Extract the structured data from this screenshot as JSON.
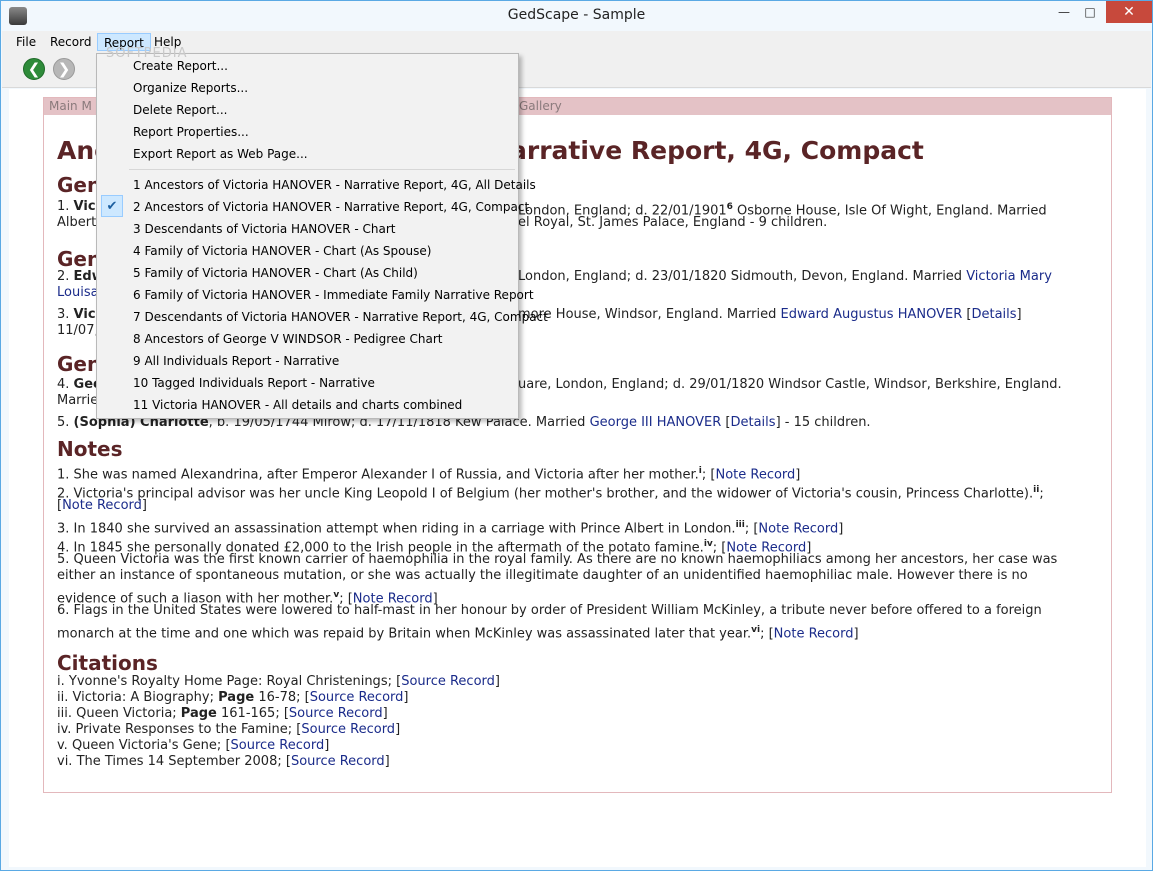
{
  "window": {
    "title": "GedScape - Sample",
    "min_label": "—",
    "max_label": "□",
    "close_label": "✕"
  },
  "menubar": {
    "file": "File",
    "record": "Record",
    "report": "Report",
    "help": "Help"
  },
  "toolbar": {
    "back_icon": "❮",
    "forward_icon": "❯"
  },
  "watermark": "SOFTPEDIA",
  "tabs": {
    "main": "Main M",
    "gallery": "Gallery"
  },
  "report_menu": {
    "actions": [
      "Create Report...",
      "Organize Reports...",
      "Delete Report...",
      "Report Properties...",
      "Export Report as Web Page..."
    ],
    "reports": [
      "1 Ancestors of Victoria HANOVER - Narrative Report, 4G, All Details",
      "2 Ancestors of Victoria HANOVER - Narrative Report, 4G, Compact",
      "3 Descendants of Victoria HANOVER - Chart",
      "4 Family of Victoria HANOVER - Chart (As Spouse)",
      "5 Family of Victoria HANOVER - Chart (As Child)",
      "6 Family of Victoria HANOVER - Immediate Family Narrative Report",
      "7 Descendants of Victoria HANOVER - Narrative Report, 4G, Compact",
      "8 Ancestors of George V WINDSOR - Pedigree Chart",
      "9 All Individuals Report - Narrative",
      "10 Tagged Individuals Report - Narrative",
      "11 Victoria HANOVER - All details and charts combined"
    ],
    "checked_mark": "✔"
  },
  "report": {
    "title_left": "Anc",
    "title_right": "arrative Report, 4G, Compact",
    "gen1": "Gen",
    "gen2": "Gen",
    "gen3": "Gen",
    "line_1a_num": "1.",
    "line_1a_bold": "Vic",
    "line_1a_tail": "London, England; d. 22/01/1901",
    "line_1a_sup": "6",
    "line_1a_tail2": " Osborne House, Isle Of Wight, England. Married",
    "line_1b_head": "Albert",
    "line_1b_tail": "el Royal, St. James Palace, England - 9 children.",
    "line_2a_num": "2.",
    "line_2a_bold": "Edw",
    "line_2a_tail": "London, England; d. 23/01/1820 Sidmouth, Devon, England. Married ",
    "line_2a_link": "Victoria Mary",
    "line_2b_link": "Louisa",
    "line_3a_num": "3.",
    "line_3a_bold": "Vic",
    "line_3a_tail": "more House, Windsor, England. Married ",
    "line_3a_link": "Edward Augustus HANOVER",
    "line_3a_bracket_open": " [",
    "line_3a_details": "Details",
    "line_3a_bracket_close": "]",
    "line_3b_head": "11/07,",
    "line_4a_num": "4.",
    "line_4a_bold": "Geo",
    "line_4a_tail": "uare, London, England; d. 29/01/1820 Windsor Castle, Windsor, Berkshire, England.",
    "line_4b_head": "Marrie",
    "line_5_num": "5. ",
    "line_5_bold": "(Sophia) Charlotte",
    "line_5_tail": ", b. 19/05/1744 Mirow; d. 17/11/1818 Kew Palace. Married ",
    "line_5_link": "George III HANOVER",
    "line_5_details": "Details",
    "line_5_end": " - 15 children.",
    "notes_heading": "Notes",
    "notes": [
      {
        "text": "1. She was named Alexandrina, after Emperor Alexander I of Russia, and Victoria after her mother.",
        "sup": "i",
        "link": "Note Record"
      },
      {
        "text": "2. Victoria's principal advisor was her uncle King Leopold I of Belgium (her mother's brother, and the widower of Victoria's cousin, Princess Charlotte).",
        "sup": "ii",
        "link": "Note Record"
      },
      {
        "text": "3. In 1840 she survived an assassination attempt when riding in a carriage with Prince Albert in London.",
        "sup": "iii",
        "link": "Note Record"
      },
      {
        "text": "4. In 1845 she personally donated £2,000 to the Irish people in the aftermath of the potato famine.",
        "sup": "iv",
        "link": "Note Record"
      },
      {
        "text_l1": "5. Queen Victoria was the first known carrier of haemophilia in the royal family. As there are no known haemophiliacs among her ancestors, her case was",
        "text_l2": "either an instance of spontaneous mutation, or she was actually the illegitimate daughter of an unidentified haemophiliac male. However there is no",
        "text_l3": "evidence of such a liason with her mother.",
        "sup": "v",
        "link": "Note Record"
      },
      {
        "text_l1": "6. Flags in the United States were lowered to half-mast in her honour by order of President William McKinley, a tribute never before offered to a foreign",
        "text_l2": "monarch at the time and one which was repaid by Britain when McKinley was assassinated later that year.",
        "sup": "vi",
        "link": "Note Record"
      }
    ],
    "citations_heading": "Citations",
    "citations": [
      {
        "pre": "i. Yvonne's Royalty Home Page: Royal Christenings; ",
        "bold": "",
        "mid": "",
        "link": "Source Record"
      },
      {
        "pre": "ii. Victoria: A Biography; ",
        "bold": "Page",
        "mid": " 16-78; ",
        "link": "Source Record"
      },
      {
        "pre": "iii. Queen Victoria; ",
        "bold": "Page",
        "mid": " 161-165; ",
        "link": "Source Record"
      },
      {
        "pre": "iv. Private Responses to the Famine; ",
        "bold": "",
        "mid": "",
        "link": "Source Record"
      },
      {
        "pre": "v. Queen Victoria's Gene; ",
        "bold": "",
        "mid": "",
        "link": "Source Record"
      },
      {
        "pre": "vi. The Times 14 September 2008; ",
        "bold": "",
        "mid": "",
        "link": "Source Record"
      }
    ],
    "semi": "; [",
    "close": "]",
    "open": "[",
    "semi_end": ";"
  }
}
